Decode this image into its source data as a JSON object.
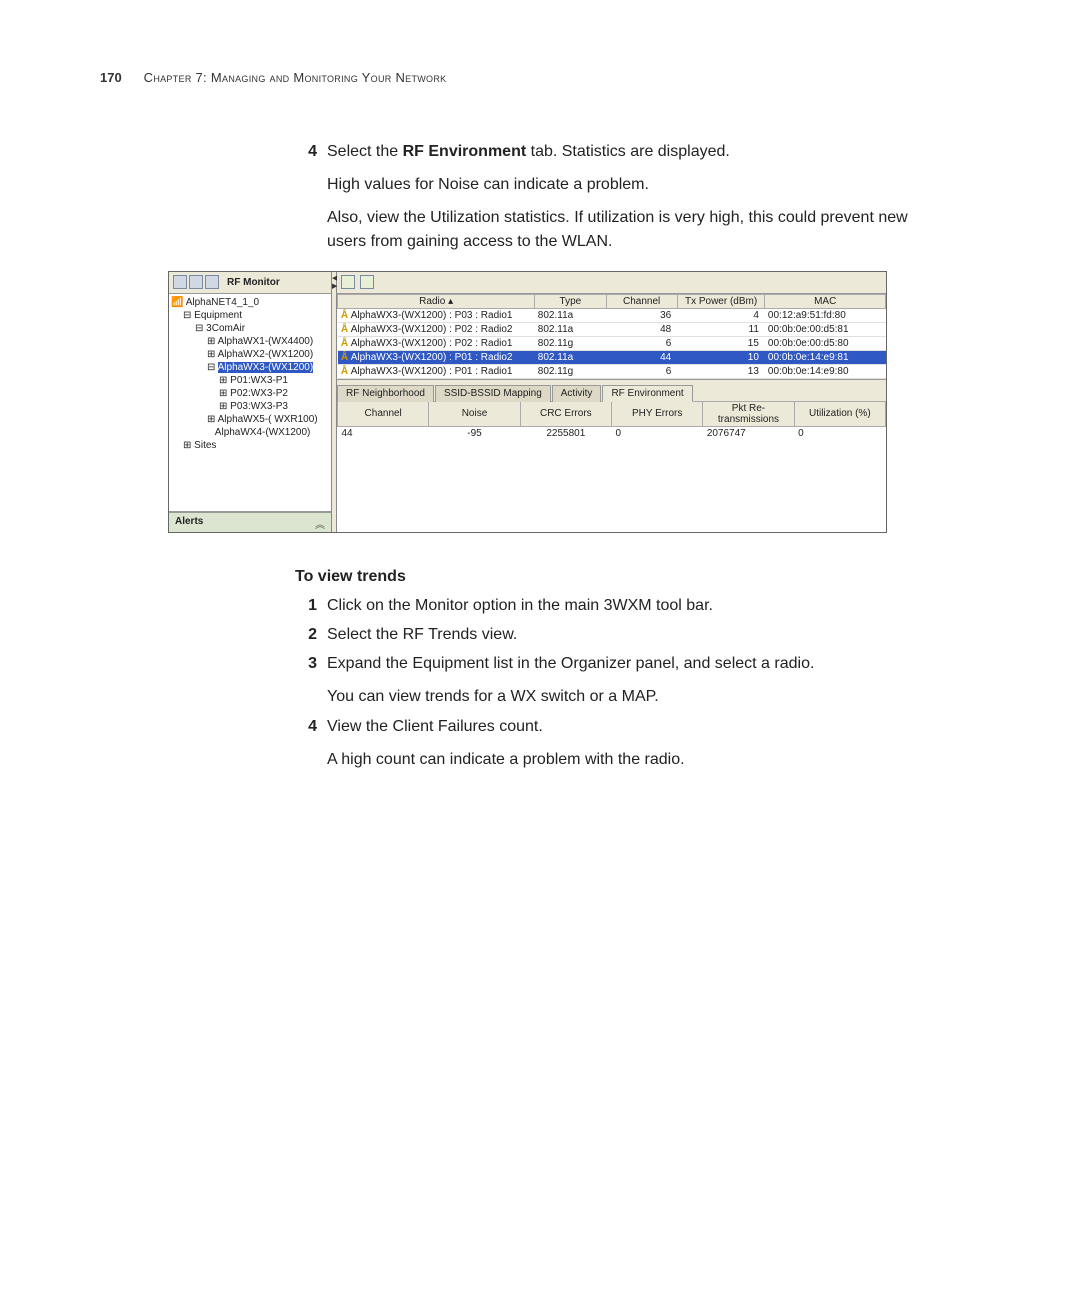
{
  "page_number": "170",
  "chapter_heading": "Chapter 7: Managing and Monitoring Your Network",
  "step4": {
    "num": "4",
    "text_a": "Select the ",
    "text_b": "RF Environment",
    "text_c": " tab. Statistics are displayed.",
    "p2": "High values for Noise can indicate a problem.",
    "p3": "Also, view the Utilization statistics. If utilization is very high, this could prevent new users from gaining access to the WLAN."
  },
  "app": {
    "left_title": "RF Monitor",
    "tree": {
      "root": "AlphaNET4_1_0",
      "equip": "Equipment",
      "group": "3ComAir",
      "items": [
        "AlphaWX1-(WX4400)",
        "AlphaWX2-(WX1200)"
      ],
      "selected": "AlphaWX3-(WX1200)",
      "ports": [
        "P01:WX3-P1",
        "P02:WX3-P2",
        "P03:WX3-P3"
      ],
      "after": [
        "AlphaWX5-( WXR100)",
        "AlphaWX4-(WX1200)"
      ],
      "sites": "Sites"
    },
    "alerts": "Alerts",
    "main_table": {
      "headers": [
        "Radio ▴",
        "Type",
        "Channel",
        "Tx Power (dBm)",
        "MAC"
      ],
      "rows": [
        {
          "radio": "AlphaWX3-(WX1200) : P03 : Radio1",
          "type": "802.11a",
          "chan": "36",
          "tx": "4",
          "mac": "00:12:a9:51:fd:80"
        },
        {
          "radio": "AlphaWX3-(WX1200) : P02 : Radio2",
          "type": "802.11a",
          "chan": "48",
          "tx": "11",
          "mac": "00:0b:0e:00:d5:81"
        },
        {
          "radio": "AlphaWX3-(WX1200) : P02 : Radio1",
          "type": "802.11g",
          "chan": "6",
          "tx": "15",
          "mac": "00:0b:0e:00:d5:80"
        },
        {
          "radio": "AlphaWX3-(WX1200) : P01 : Radio2",
          "type": "802.11a",
          "chan": "44",
          "tx": "10",
          "mac": "00:0b:0e:14:e9:81",
          "hl": true
        },
        {
          "radio": "AlphaWX3-(WX1200) : P01 : Radio1",
          "type": "802.11g",
          "chan": "6",
          "tx": "13",
          "mac": "00:0b:0e:14:e9:80"
        }
      ]
    },
    "tabs": [
      "RF Neighborhood",
      "SSID-BSSID Mapping",
      "Activity",
      "RF Environment"
    ],
    "active_tab": 3,
    "env_table": {
      "headers": [
        "Channel",
        "Noise",
        "CRC Errors",
        "PHY Errors",
        "Pkt Re-transmissions",
        "Utilization (%)"
      ],
      "row": {
        "chan": "44",
        "noise": "-95",
        "crc": "2255801",
        "phy": "0",
        "pkt": "2076747",
        "util": "0"
      }
    }
  },
  "trends_heading": "To view trends",
  "trends": [
    {
      "num": "1",
      "text": "Click on the Monitor option in the main 3WXM tool bar."
    },
    {
      "num": "2",
      "text": "Select the RF Trends view."
    },
    {
      "num": "3",
      "text": "Expand the Equipment list in the Organizer panel, and select a radio.",
      "sub": "You can view trends for a WX switch or a MAP."
    },
    {
      "num": "4",
      "text": "View the Client Failures count.",
      "sub": "A high count can indicate a problem with the radio."
    }
  ]
}
